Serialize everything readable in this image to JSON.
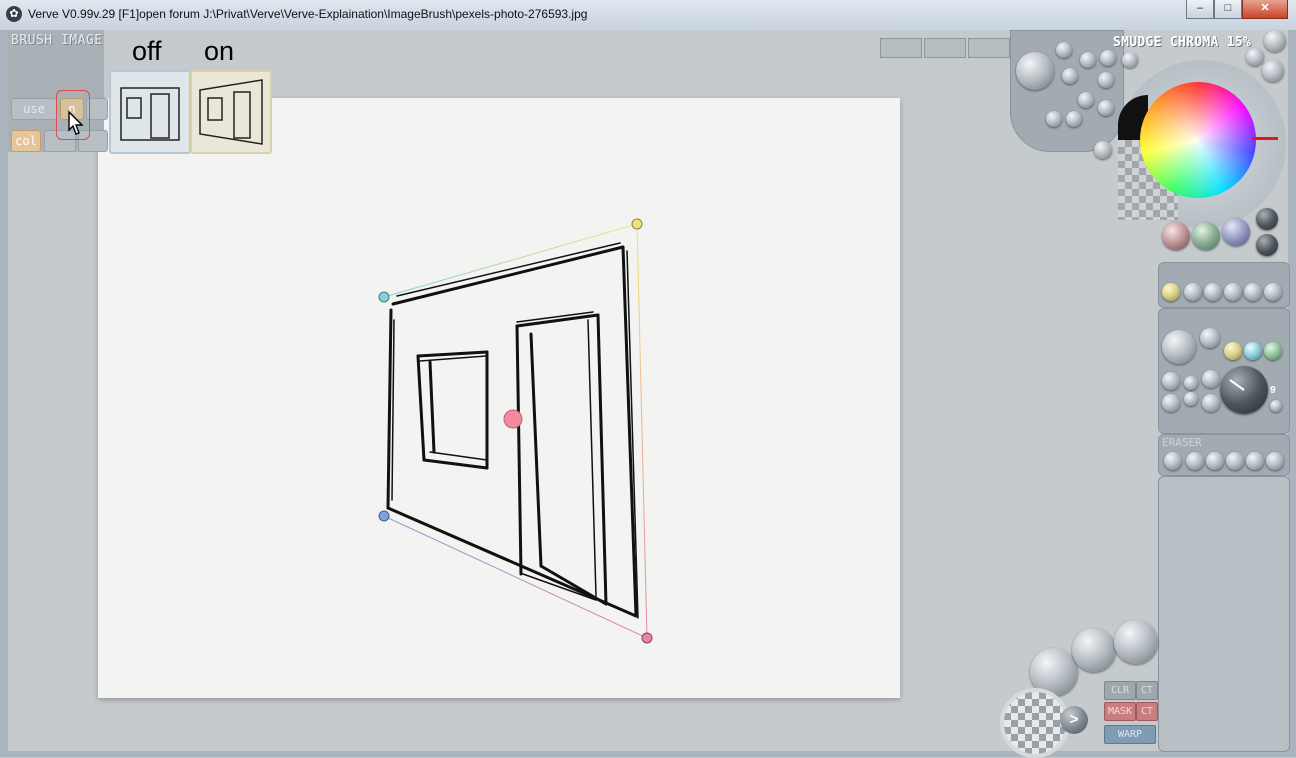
{
  "window": {
    "title": "Verve V0.99v.29 [F1]open forum   J:\\Privat\\Verve\\Verve-Explaination\\ImageBrush\\pexels-photo-276593.jpg",
    "icon": "verve-app-icon",
    "controls": {
      "minimize": "‒",
      "maximize": "□",
      "close": "✕"
    }
  },
  "brush_image_panel": {
    "title": "BRUSH IMAGE",
    "use_label": "use",
    "n_label": "n",
    "col_label": "col"
  },
  "thumbnails": {
    "off_label": "off",
    "on_label": "on"
  },
  "right_panel": {
    "status": "SMUDGE CHROMA 15%",
    "eraser_label": "ERASER",
    "dial_readout": "9"
  },
  "bottom_buttons": {
    "clr": "CLR",
    "ct": "CT",
    "mask": "MASK",
    "mask2": "CT",
    "warp": "WARP",
    "arrow": ">"
  },
  "colors": {
    "accent_red": "#e04a4a",
    "handle_top_left": "#7fd3d8",
    "handle_top_right": "#f0e27a",
    "handle_bottom_left": "#7fa2d8",
    "handle_bottom_right": "#e884a8",
    "center_handle": "#f08a9e"
  }
}
